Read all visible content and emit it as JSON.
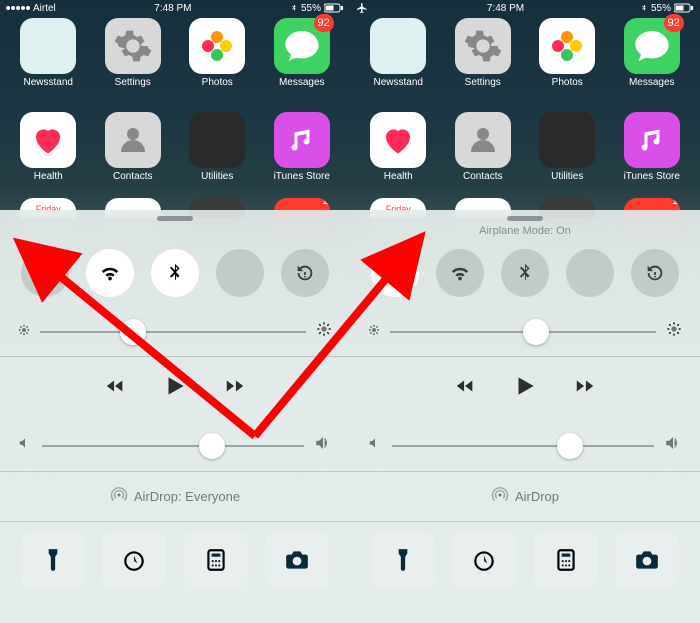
{
  "left": {
    "status": {
      "carrier": "Airtel",
      "time": "7:48 PM",
      "bt": "55%",
      "plane_badge": ""
    },
    "apps_row1": [
      {
        "label": "Newsstand",
        "bg": "#dff0f0"
      },
      {
        "label": "Settings",
        "bg": "#d8d8d8"
      },
      {
        "label": "Photos",
        "bg": "#ffffff"
      },
      {
        "label": "Messages",
        "bg": "#3dd261",
        "badge": "92"
      }
    ],
    "apps_row2": [
      {
        "label": "Health",
        "bg": "#ffffff"
      },
      {
        "label": "Contacts",
        "bg": "#d8d8d8"
      },
      {
        "label": "Utilities",
        "bg": "#2a2a2a"
      },
      {
        "label": "iTunes Store",
        "bg": "#d850e8"
      }
    ],
    "partial": [
      {
        "bg": "#ffffff",
        "text": "Friday"
      },
      {
        "bg": "#ffffff",
        "text": ""
      },
      {
        "bg": "#3a3a3a",
        "text": ""
      },
      {
        "bg": "#ff3b30",
        "text": "",
        "badge": "1"
      }
    ],
    "cc_status_text": "",
    "toggles": {
      "airplane": false,
      "wifi": true,
      "bt": true,
      "dnd": false,
      "lock": false
    },
    "brightness": 0.35,
    "volume": 0.65,
    "airdrop_label": "AirDrop: Everyone"
  },
  "right": {
    "status": {
      "carrier": "",
      "time": "7:48 PM",
      "bt": "55%"
    },
    "apps_row1": [
      {
        "label": "Newsstand",
        "bg": "#dff0f0"
      },
      {
        "label": "Settings",
        "bg": "#d8d8d8"
      },
      {
        "label": "Photos",
        "bg": "#ffffff"
      },
      {
        "label": "Messages",
        "bg": "#3dd261",
        "badge": "92"
      }
    ],
    "apps_row2": [
      {
        "label": "Health",
        "bg": "#ffffff"
      },
      {
        "label": "Contacts",
        "bg": "#d8d8d8"
      },
      {
        "label": "Utilities",
        "bg": "#2a2a2a"
      },
      {
        "label": "iTunes Store",
        "bg": "#d850e8"
      }
    ],
    "partial": [
      {
        "bg": "#ffffff",
        "text": "Friday"
      },
      {
        "bg": "#ffffff",
        "text": ""
      },
      {
        "bg": "#3a3a3a",
        "text": ""
      },
      {
        "bg": "#ff3b30",
        "text": "",
        "badge": "1"
      }
    ],
    "cc_status_text": "Airplane Mode: On",
    "toggles": {
      "airplane": true,
      "wifi": false,
      "bt": false,
      "dnd": false,
      "lock": false
    },
    "brightness": 0.55,
    "volume": 0.68,
    "airdrop_label": "AirDrop"
  },
  "quick_apps": [
    "flashlight",
    "timer",
    "calculator",
    "camera"
  ],
  "media": {
    "prev": "prev",
    "play": "play",
    "next": "next"
  }
}
